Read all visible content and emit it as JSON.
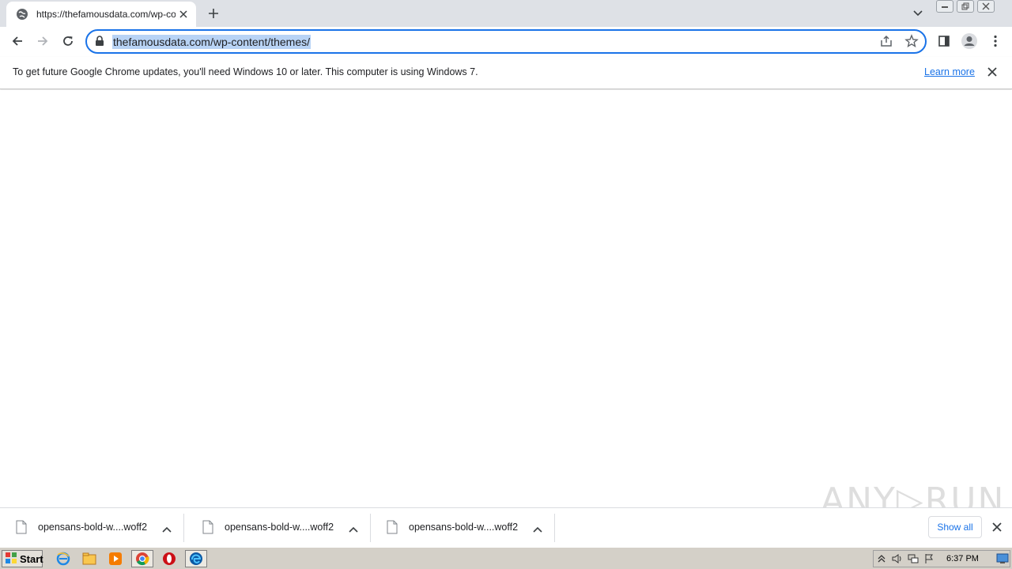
{
  "tab": {
    "title": "https://thefamousdata.com/wp-conte",
    "favicon": "globe-icon",
    "close_icon": "close-icon"
  },
  "toolbar": {
    "url": "thefamousdata.com/wp-content/themes/",
    "icons": [
      "back-arrow-icon",
      "forward-arrow-icon",
      "reload-icon",
      "lock-icon",
      "share-icon",
      "bookmark-star-icon",
      "side-panel-icon",
      "profile-icon",
      "more-menu-icon"
    ]
  },
  "infobar": {
    "message": "To get future Google Chrome updates, you'll need Windows 10 or later. This computer is using Windows 7.",
    "link": "Learn more"
  },
  "downloads": {
    "items": [
      {
        "name": "opensans-bold-w....woff2"
      },
      {
        "name": "opensans-bold-w....woff2"
      },
      {
        "name": "opensans-bold-w....woff2"
      }
    ],
    "show_all": "Show all"
  },
  "watermark": "ANY RUN",
  "taskbar": {
    "start_label": "Start",
    "clock": "6:37 PM"
  },
  "colors": {
    "accent": "#1a73e8",
    "tabstrip": "#dee1e6",
    "taskbar": "#d4d0c8",
    "url_highlight": "#b8d3f5"
  }
}
